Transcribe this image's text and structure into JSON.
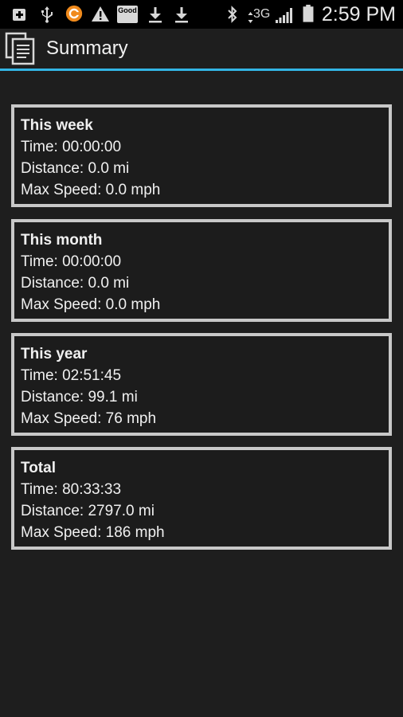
{
  "status_bar": {
    "time": "2:59 PM",
    "network_type": "3G",
    "good_label": "Good",
    "icons": [
      "add-icon",
      "usb-icon",
      "sync-orange-icon",
      "warning-icon",
      "good-app-icon",
      "download-icon",
      "download-icon",
      "bluetooth-icon",
      "signal-icon",
      "battery-icon"
    ]
  },
  "action_bar": {
    "title": "Summary",
    "icon": "document-stack-icon",
    "accent_color": "#33b5e5"
  },
  "cards": [
    {
      "title": "This week",
      "time": "Time: 00:00:00",
      "distance": "Distance: 0.0 mi",
      "max_speed": "Max Speed: 0.0 mph"
    },
    {
      "title": "This month",
      "time": "Time: 00:00:00",
      "distance": "Distance: 0.0 mi",
      "max_speed": "Max Speed: 0.0 mph"
    },
    {
      "title": "This year",
      "time": "Time: 02:51:45",
      "distance": "Distance: 99.1 mi",
      "max_speed": "Max Speed: 76 mph"
    },
    {
      "title": "Total",
      "time": "Time: 80:33:33",
      "distance": "Distance: 2797.0 mi",
      "max_speed": "Max Speed: 186 mph"
    }
  ]
}
